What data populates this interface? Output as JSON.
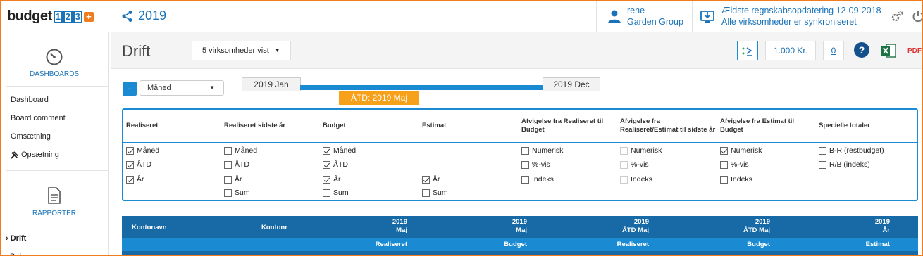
{
  "app": {
    "logo_text": "budget",
    "logo_nums": [
      "1",
      "2",
      "3"
    ],
    "logo_plus": "+"
  },
  "topbar": {
    "period": "2019",
    "user_name": "rene",
    "company": "Garden Group",
    "sync_line1": "Ældste regnskabsopdatering 12-09-2018",
    "sync_line2": "Alle virksomheder er synkroniseret",
    "accent": "#1a73b8"
  },
  "sidebar": {
    "dashboards_label": "DASHBOARDS",
    "dash_links": [
      "Dashboard",
      "Board comment",
      "Omsætning",
      "Opsætning"
    ],
    "reports_label": "RAPPORTER",
    "report_links": [
      "Drift",
      "Bal"
    ]
  },
  "page": {
    "title": "Drift",
    "company_filter": "5 virksomheder vist",
    "amount_unit": "1.000 Kr.",
    "zero_button": "0",
    "help": "?",
    "pdf": "PDF"
  },
  "period_controls": {
    "granularity": "Måned",
    "start": "2019 Jan",
    "end": "2019 Dec",
    "atd": "ÅTD: 2019 Maj",
    "collapse": "-"
  },
  "options": {
    "headers": [
      "Realiseret",
      "Realiseret sidste år",
      "Budget",
      "Estimat",
      "Afvigelse fra Realiseret til Budget",
      "Afvigelse fra Realiseret/Estimat til sidste år",
      "Afvigelse fra Estimat til Budget",
      "Specielle totaler"
    ],
    "realiseret": [
      {
        "label": "Måned",
        "checked": true
      },
      {
        "label": "ÅTD",
        "checked": true
      },
      {
        "label": "År",
        "checked": true
      }
    ],
    "sidste_aar": [
      {
        "label": "Måned",
        "checked": false
      },
      {
        "label": "ÅTD",
        "checked": false
      },
      {
        "label": "År",
        "checked": false
      },
      {
        "label": "Sum",
        "checked": false
      }
    ],
    "budget": [
      {
        "label": "Måned",
        "checked": true
      },
      {
        "label": "ÅTD",
        "checked": true
      },
      {
        "label": "År",
        "checked": true
      },
      {
        "label": "Sum",
        "checked": false
      }
    ],
    "estimat": [
      {
        "label": "År",
        "checked": true
      },
      {
        "label": "Sum",
        "checked": false
      }
    ],
    "afv_real_budget": [
      {
        "label": "Numerisk",
        "checked": false
      },
      {
        "label": "%-vis",
        "checked": false
      },
      {
        "label": "Indeks",
        "checked": false
      }
    ],
    "afv_real_sidste": [
      {
        "label": "Numerisk",
        "checked": false
      },
      {
        "label": "%-vis",
        "checked": false
      },
      {
        "label": "Indeks",
        "checked": false
      }
    ],
    "afv_est_budget": [
      {
        "label": "Numerisk",
        "checked": true
      },
      {
        "label": "%-vis",
        "checked": false
      },
      {
        "label": "Indeks",
        "checked": false
      }
    ],
    "special": [
      {
        "label": "B-R (restbudget)",
        "checked": false
      },
      {
        "label": "R/B (indeks)",
        "checked": false
      }
    ]
  },
  "table": {
    "col_kontonavn": "Kontonavn",
    "col_kontonr": "Kontonr",
    "columns": [
      {
        "year": "2019",
        "period": "Maj",
        "type": "Realiseret"
      },
      {
        "year": "2019",
        "period": "Maj",
        "type": "Budget"
      },
      {
        "year": "2019",
        "period": "ÅTD Maj",
        "type": "Realiseret"
      },
      {
        "year": "2019",
        "period": "ÅTD Maj",
        "type": "Budget"
      },
      {
        "year": "2019",
        "period": "År",
        "type": "Estimat"
      }
    ]
  }
}
